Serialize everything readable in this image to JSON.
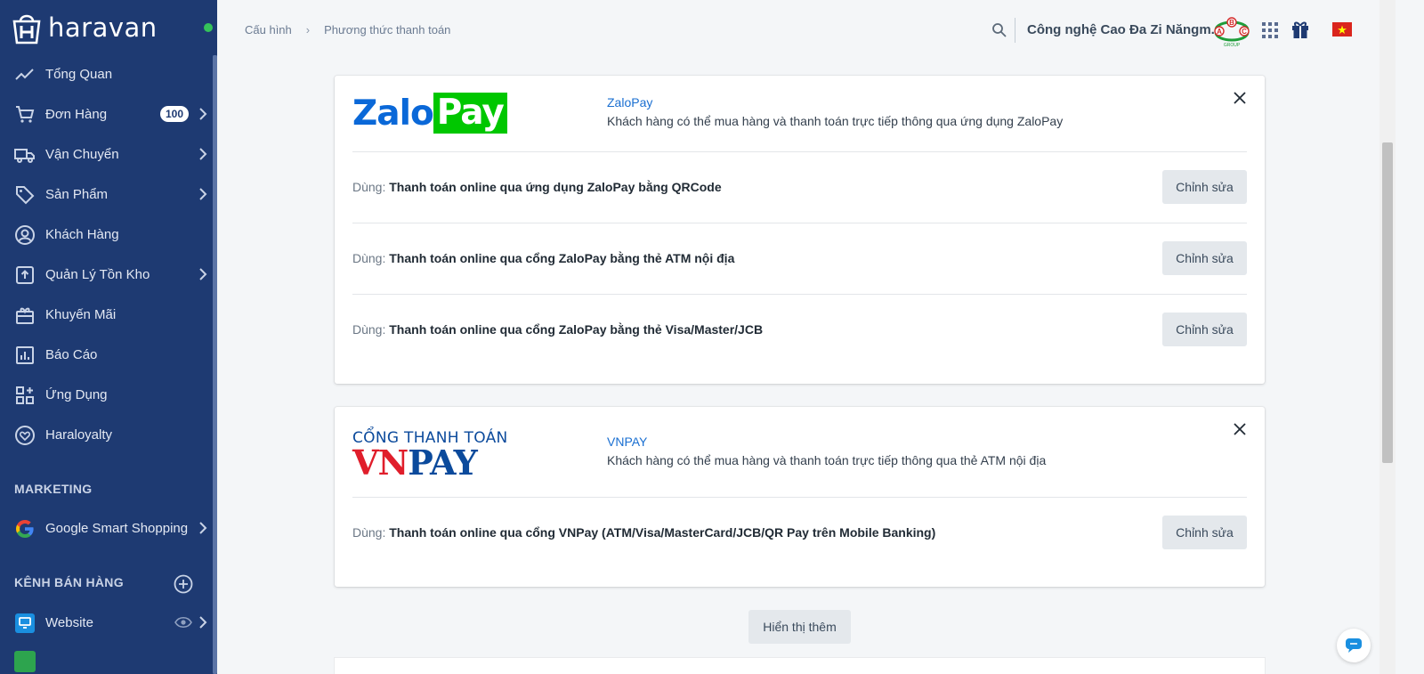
{
  "brand": {
    "name": "haravan",
    "online_color": "#35c35a",
    "logo_icon": "haravan-bag-icon"
  },
  "sidebar": {
    "items": [
      {
        "label": "Tổng Quan",
        "icon": "trend-icon"
      },
      {
        "label": "Đơn Hàng",
        "icon": "cart-icon",
        "badge": "100"
      },
      {
        "label": "Vận Chuyển",
        "icon": "truck-icon"
      },
      {
        "label": "Sản Phẩm",
        "icon": "tag-icon"
      },
      {
        "label": "Khách Hàng",
        "icon": "user-circle-icon"
      },
      {
        "label": "Quản Lý Tồn Kho",
        "icon": "inventory-icon"
      },
      {
        "label": "Khuyến Mãi",
        "icon": "promotion-icon"
      },
      {
        "label": "Báo Cáo",
        "icon": "report-icon"
      },
      {
        "label": "Ứng Dụng",
        "icon": "apps-grid-icon"
      },
      {
        "label": "Haraloyalty",
        "icon": "heart-circle-icon"
      }
    ],
    "marketing_title": "MARKETING",
    "marketing_items": [
      {
        "label": "Google Smart Shopping",
        "icon": "google-icon"
      }
    ],
    "channels_title": "KÊNH BÁN HÀNG",
    "channel_items": [
      {
        "label": "Website",
        "icon": "website-icon"
      }
    ]
  },
  "header": {
    "breadcrumb": [
      "Cấu hình",
      "Phương thức thanh toán"
    ],
    "store_name": "Công nghệ Cao Đa Zi Năngm...",
    "store_logo_text": {
      "a": "A",
      "b": "B",
      "c": "C",
      "group": "GROUP"
    }
  },
  "providers": [
    {
      "logo": {
        "part1": "Zalo",
        "part2": "Pay"
      },
      "title": "ZaloPay",
      "description": "Khách hàng có thể mua hàng và thanh toán trực tiếp thông qua ứng dụng ZaloPay",
      "methods": [
        {
          "prefix": "Dùng:",
          "name": "Thanh toán online qua ứng dụng ZaloPay bằng QRCode",
          "button": "Chỉnh sửa"
        },
        {
          "prefix": "Dùng:",
          "name": "Thanh toán online qua cổng ZaloPay bằng thẻ ATM nội địa",
          "button": "Chỉnh sửa"
        },
        {
          "prefix": "Dùng:",
          "name": "Thanh toán online qua cổng ZaloPay bằng thẻ Visa/Master/JCB",
          "button": "Chỉnh sửa"
        }
      ]
    },
    {
      "logo": {
        "line1": "CỔNG THANH TOÁN",
        "vn": "VN",
        "pay": "PAY"
      },
      "title": "VNPAY",
      "description": "Khách hàng có thể mua hàng và thanh toán trực tiếp thông qua thẻ ATM nội địa",
      "methods": [
        {
          "prefix": "Dùng:",
          "name": "Thanh toán online qua cổng VNPay (ATM/Visa/MasterCard/JCB/QR Pay trên Mobile Banking)",
          "button": "Chỉnh sửa"
        }
      ]
    }
  ],
  "show_more_label": "Hiển thị thêm",
  "colors": {
    "sidebar": "#1e3a72",
    "link": "#1a6fd1",
    "zalo_blue": "#0a68d8",
    "zalo_green": "#00c700",
    "vnpay_red": "#e01e2b",
    "vnpay_blue": "#0b4a9c"
  }
}
